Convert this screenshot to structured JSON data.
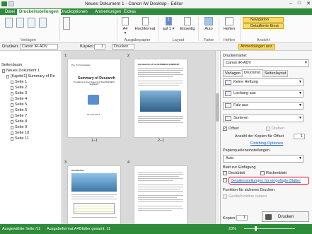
{
  "window": {
    "title": "Neues Dokument 1 - Canon iW Desktop - Editor",
    "controls": [
      "–",
      "□",
      "✕"
    ]
  },
  "tabs": [
    "Datei",
    "Druckeinstellungen",
    "Druckoptionen",
    "Anmerkungen",
    "Extras"
  ],
  "ribbon": {
    "vorlagen": {
      "label": "Vorlagen"
    },
    "paper": {
      "size": "A4",
      "size_arrow": "▾",
      "orientation": "Hochformat",
      "group": "Ausgabepapier"
    },
    "layout": {
      "value": "1",
      "sub": "auf 1 ▾",
      "duplex": "Einseitig",
      "group": "Layout"
    },
    "farbe": {
      "value": "Auto",
      "group": "Farbe"
    },
    "heften": {
      "label": "Heften",
      "group": "Heften"
    },
    "ansicht": {
      "navigation": "Navigation",
      "detail": "Detaillierte Einst",
      "group": "Ansicht"
    }
  },
  "toolbar": {
    "drucken_label": "Drucken:",
    "printer": "Canon iR-ADV",
    "kopien_label": "Kopien:",
    "kopien": "1",
    "drucken_btn": "Drucken",
    "anmerkungen": "Anmerkungen anz."
  },
  "tree": {
    "header": "Seitenbaum",
    "root": "Neues Dokument 1",
    "chapter": "[Kapitel1] Summary of Re",
    "pages": [
      "Seite 1",
      "Seite 2",
      "Seite 3",
      "Seite 4",
      "Seite 5",
      "Seite 6",
      "Seite 7",
      "Seite 8",
      "Seite 9",
      "Seite 10",
      "Seite 11"
    ]
  },
  "preview": {
    "pages": [
      {
        "num": "1",
        "caption": "1–1",
        "title": "Summary of Research",
        "sub": "The Effects of Cloud Systems of TEAL BUSINESS SUMMARY",
        "date": "27 June 2017",
        "org": "Pro. XX Corporation"
      },
      {
        "num": "2",
        "caption": "2–1",
        "heading": "Introduction of the BUSINESS SUMMARY"
      },
      {
        "num": "3",
        "heading": "Introduction"
      },
      {
        "num": "4"
      }
    ]
  },
  "right": {
    "printer_label": "Druckername:",
    "printer": "Canon iR-ADV",
    "tabs": [
      "Vorlagen",
      "Druckinst.",
      "Seitenlayout"
    ],
    "heftung": "Keine Heftung",
    "lochung": "Lochung aus",
    "falz": "Falz aus",
    "sorteren": "Sorteren",
    "offset": "Offset",
    "drehen": "Drehen",
    "anzahl_label": "Anzahl der Kopien für Offset",
    "anzahl": "1",
    "finishing": "Finishing-Optionen",
    "papierquelle_label": "Papierquelleneinstellungen",
    "papierquelle": "Auto",
    "einfuegung_label": "Blatt zur Einfügung",
    "deckblatt": "Deckblatt",
    "rueckenblatt": "Rückenblatt",
    "detail_link": "Detaileinstellungen für eingefügte Blätter",
    "sicher_label": "Funktion für sicheres Drucken",
    "geraet": "Gerätefunktion nutzen",
    "kopien_label": "Kopien:",
    "kopien": "1",
    "drucken": "Drucken",
    "highlight_color": "#e0001a"
  },
  "status": {
    "ausgabe": "Ausgewählte Seite /11",
    "format": "Ausgabeformat:A4",
    "gesamt": "Blätter gesamt: 11",
    "zoom": "23%"
  },
  "colors": {
    "accent": "#2e8b3a"
  }
}
